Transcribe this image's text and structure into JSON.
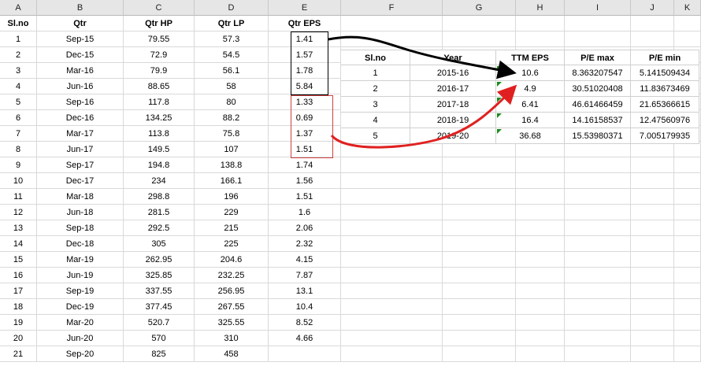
{
  "columns": [
    "A",
    "B",
    "C",
    "D",
    "E",
    "F",
    "G",
    "H",
    "I",
    "J",
    "K"
  ],
  "headers": {
    "slno": "Sl.no",
    "qtr": "Qtr",
    "hp": "Qtr HP",
    "lp": "Qtr LP",
    "eps": "Qtr EPS"
  },
  "rows": [
    {
      "slno": "1",
      "qtr": "Sep-15",
      "hp": "79.55",
      "lp": "57.3",
      "eps": "1.41"
    },
    {
      "slno": "2",
      "qtr": "Dec-15",
      "hp": "72.9",
      "lp": "54.5",
      "eps": "1.57"
    },
    {
      "slno": "3",
      "qtr": "Mar-16",
      "hp": "79.9",
      "lp": "56.1",
      "eps": "1.78"
    },
    {
      "slno": "4",
      "qtr": "Jun-16",
      "hp": "88.65",
      "lp": "58",
      "eps": "5.84"
    },
    {
      "slno": "5",
      "qtr": "Sep-16",
      "hp": "117.8",
      "lp": "80",
      "eps": "1.33"
    },
    {
      "slno": "6",
      "qtr": "Dec-16",
      "hp": "134.25",
      "lp": "88.2",
      "eps": "0.69"
    },
    {
      "slno": "7",
      "qtr": "Mar-17",
      "hp": "113.8",
      "lp": "75.8",
      "eps": "1.37"
    },
    {
      "slno": "8",
      "qtr": "Jun-17",
      "hp": "149.5",
      "lp": "107",
      "eps": "1.51"
    },
    {
      "slno": "9",
      "qtr": "Sep-17",
      "hp": "194.8",
      "lp": "138.8",
      "eps": "1.74"
    },
    {
      "slno": "10",
      "qtr": "Dec-17",
      "hp": "234",
      "lp": "166.1",
      "eps": "1.56"
    },
    {
      "slno": "11",
      "qtr": "Mar-18",
      "hp": "298.8",
      "lp": "196",
      "eps": "1.51"
    },
    {
      "slno": "12",
      "qtr": "Jun-18",
      "hp": "281.5",
      "lp": "229",
      "eps": "1.6"
    },
    {
      "slno": "13",
      "qtr": "Sep-18",
      "hp": "292.5",
      "lp": "215",
      "eps": "2.06"
    },
    {
      "slno": "14",
      "qtr": "Dec-18",
      "hp": "305",
      "lp": "225",
      "eps": "2.32"
    },
    {
      "slno": "15",
      "qtr": "Mar-19",
      "hp": "262.95",
      "lp": "204.6",
      "eps": "4.15"
    },
    {
      "slno": "16",
      "qtr": "Jun-19",
      "hp": "325.85",
      "lp": "232.25",
      "eps": "7.87"
    },
    {
      "slno": "17",
      "qtr": "Sep-19",
      "hp": "337.55",
      "lp": "256.95",
      "eps": "13.1"
    },
    {
      "slno": "18",
      "qtr": "Dec-19",
      "hp": "377.45",
      "lp": "267.55",
      "eps": "10.4"
    },
    {
      "slno": "19",
      "qtr": "Mar-20",
      "hp": "520.7",
      "lp": "325.55",
      "eps": "8.52"
    },
    {
      "slno": "20",
      "qtr": "Jun-20",
      "hp": "570",
      "lp": "310",
      "eps": "4.66"
    },
    {
      "slno": "21",
      "qtr": "Sep-20",
      "hp": "825",
      "lp": "458",
      "eps": ""
    }
  ],
  "summary": {
    "headers": {
      "slno": "Sl.no",
      "year": "Year",
      "ttm": "TTM EPS",
      "pemax": "P/E max",
      "pemin": "P/E min"
    },
    "rows": [
      {
        "slno": "1",
        "year": "2015-16",
        "ttm": "10.6",
        "pemax": "8.363207547",
        "pemin": "5.141509434"
      },
      {
        "slno": "2",
        "year": "2016-17",
        "ttm": "4.9",
        "pemax": "30.51020408",
        "pemin": "11.83673469"
      },
      {
        "slno": "3",
        "year": "2017-18",
        "ttm": "6.41",
        "pemax": "46.61466459",
        "pemin": "21.65366615"
      },
      {
        "slno": "4",
        "year": "2018-19",
        "ttm": "16.4",
        "pemax": "14.16158537",
        "pemin": "12.47560976"
      },
      {
        "slno": "5",
        "year": "2019-20",
        "ttm": "36.68",
        "pemax": "15.53980371",
        "pemin": "7.005179935"
      }
    ]
  },
  "colors": {
    "arrow_black": "#000000",
    "arrow_red": "#e02020",
    "box_black": "#000000",
    "box_red": "#d04040",
    "error_indicator": "#1a8a1a"
  }
}
